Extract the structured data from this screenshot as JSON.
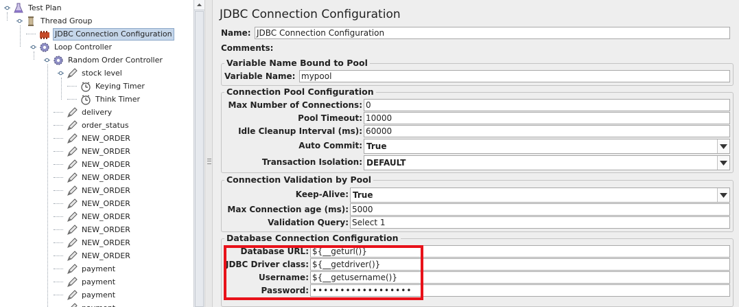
{
  "tree": {
    "items": [
      {
        "label": "Test Plan",
        "icon": "flask-icon",
        "depth": 0
      },
      {
        "label": "Thread Group",
        "icon": "spool-icon",
        "depth": 1
      },
      {
        "label": "JDBC Connection Configuration",
        "icon": "config-element-icon",
        "depth": 2,
        "selected": true
      },
      {
        "label": "Loop Controller",
        "icon": "controller-gear-icon",
        "depth": 2
      },
      {
        "label": "Random Order Controller",
        "icon": "controller-gear-icon",
        "depth": 3
      },
      {
        "label": "stock level",
        "icon": "sampler-pencil-icon",
        "depth": 4
      },
      {
        "label": "Keying Timer",
        "icon": "timer-icon",
        "depth": 5
      },
      {
        "label": "Think Timer",
        "icon": "timer-icon",
        "depth": 5
      },
      {
        "label": "delivery",
        "icon": "sampler-pencil-icon",
        "depth": 4
      },
      {
        "label": "order_status",
        "icon": "sampler-pencil-icon",
        "depth": 4
      },
      {
        "label": "NEW_ORDER",
        "icon": "sampler-pencil-icon",
        "depth": 4
      },
      {
        "label": "NEW_ORDER",
        "icon": "sampler-pencil-icon",
        "depth": 4
      },
      {
        "label": "NEW_ORDER",
        "icon": "sampler-pencil-icon",
        "depth": 4
      },
      {
        "label": "NEW_ORDER",
        "icon": "sampler-pencil-icon",
        "depth": 4
      },
      {
        "label": "NEW_ORDER",
        "icon": "sampler-pencil-icon",
        "depth": 4
      },
      {
        "label": "NEW_ORDER",
        "icon": "sampler-pencil-icon",
        "depth": 4
      },
      {
        "label": "NEW_ORDER",
        "icon": "sampler-pencil-icon",
        "depth": 4
      },
      {
        "label": "NEW_ORDER",
        "icon": "sampler-pencil-icon",
        "depth": 4
      },
      {
        "label": "NEW_ORDER",
        "icon": "sampler-pencil-icon",
        "depth": 4
      },
      {
        "label": "NEW_ORDER",
        "icon": "sampler-pencil-icon",
        "depth": 4
      },
      {
        "label": "payment",
        "icon": "sampler-pencil-icon",
        "depth": 4
      },
      {
        "label": "payment",
        "icon": "sampler-pencil-icon",
        "depth": 4
      },
      {
        "label": "payment",
        "icon": "sampler-pencil-icon",
        "depth": 4
      },
      {
        "label": "payment",
        "icon": "sampler-pencil-icon",
        "depth": 4
      }
    ]
  },
  "panel": {
    "title": "JDBC Connection Configuration",
    "name_label": "Name:",
    "name_value": "JDBC Connection Configuration",
    "comments_label": "Comments:",
    "pool_binding": {
      "title": "Variable Name Bound to Pool",
      "variable_label": "Variable Name:",
      "variable_value": "mypool"
    },
    "pool_config": {
      "title": "Connection Pool Configuration",
      "max_connections_label": "Max Number of Connections:",
      "max_connections_value": "0",
      "pool_timeout_label": "Pool Timeout:",
      "pool_timeout_value": "10000",
      "idle_cleanup_label": "Idle Cleanup Interval (ms):",
      "idle_cleanup_value": "60000",
      "auto_commit_label": "Auto Commit:",
      "auto_commit_value": "True",
      "isolation_label": "Transaction Isolation:",
      "isolation_value": "DEFAULT"
    },
    "validation": {
      "title": "Connection Validation by Pool",
      "keepalive_label": "Keep-Alive:",
      "keepalive_value": "True",
      "max_age_label": "Max Connection age (ms):",
      "max_age_value": "5000",
      "query_label": "Validation Query:",
      "query_value": "Select 1"
    },
    "database": {
      "title": "Database Connection Configuration",
      "url_label": "Database URL:",
      "url_value": "${__geturl()}",
      "driver_label": "JDBC Driver class:",
      "driver_value": "${__getdriver()}",
      "username_label": "Username:",
      "username_value": "${__getusername()}",
      "password_label": "Password:",
      "password_value": "••••••••••••••••••"
    }
  },
  "colors": {
    "highlight": "#e8121a",
    "selection": "#c5d6ea",
    "background": "#eeeeee"
  }
}
